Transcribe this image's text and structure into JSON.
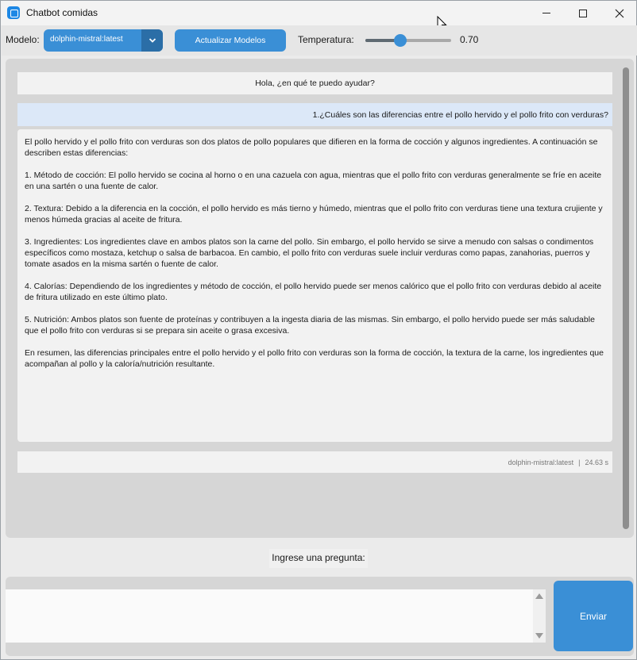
{
  "window": {
    "title": "Chatbot comidas",
    "icons": {
      "app": "chat-app-icon",
      "minimize": "minimize-icon",
      "maximize": "maximize-icon",
      "close": "close-icon"
    }
  },
  "toolbar": {
    "model_label": "Modelo:",
    "model_value": "dolphin-mistral:latest",
    "update_button": "Actualizar Modelos",
    "temperature_label": "Temperatura:",
    "temperature_value": "0.70",
    "temperature_level": 0.7
  },
  "chat": {
    "greeting": "Hola, ¿en qué te puedo ayudar?",
    "user_question": "1.¿Cuáles son las diferencias entre el pollo hervido y el pollo frito con verduras?",
    "bot_answer": "El pollo hervido y el pollo frito con verduras son dos platos de pollo populares que difieren en la forma de cocción y algunos ingredientes. A continuación se describen estas diferencias:\n\n1. Método de cocción: El pollo hervido se cocina al horno o en una cazuela con agua, mientras que el pollo frito con verduras generalmente se fríe en aceite en una sartén o una fuente de calor.\n\n2. Textura: Debido a la diferencia en la cocción, el pollo hervido es más tierno y húmedo, mientras que el pollo frito con verduras tiene una textura crujiente y menos húmeda gracias al aceite de fritura.\n\n3. Ingredientes: Los ingredientes clave en ambos platos son la carne del pollo. Sin embargo, el pollo hervido se sirve a menudo con salsas o condimentos específicos como mostaza, ketchup o salsa de barbacoa. En cambio, el pollo frito con verduras suele incluir verduras como papas, zanahorias, puerros y tomate asados en la misma sartén o fuente de calor.\n\n4. Calorías: Dependiendo de los ingredientes y método de cocción, el pollo hervido puede ser menos calórico que el pollo frito con verduras debido al aceite de fritura utilizado en este último plato.\n\n5. Nutrición: Ambos platos son fuente de proteínas y contribuyen a la ingesta diaria de las mismas. Sin embargo, el pollo hervido puede ser más saludable que el pollo frito con verduras si se prepara sin aceite o grasa excesiva.\n\nEn resumen, las diferencias principales entre el pollo hervido y el pollo frito con verduras son la forma de cocción, la textura de la carne, los ingredientes que acompañan al pollo y la caloría/nutrición resultante.",
    "meta_model": "dolphin-mistral:latest",
    "meta_separator": "|",
    "meta_time": "24.63 s"
  },
  "input": {
    "prompt_label": "Ingrese una pregunta:",
    "value": "",
    "send_button": "Enviar"
  },
  "colors": {
    "accent": "#3a8fd6",
    "accent_dark": "#2b6ea7",
    "user_bubble": "#dce8f8",
    "panel": "#d6d6d6"
  }
}
